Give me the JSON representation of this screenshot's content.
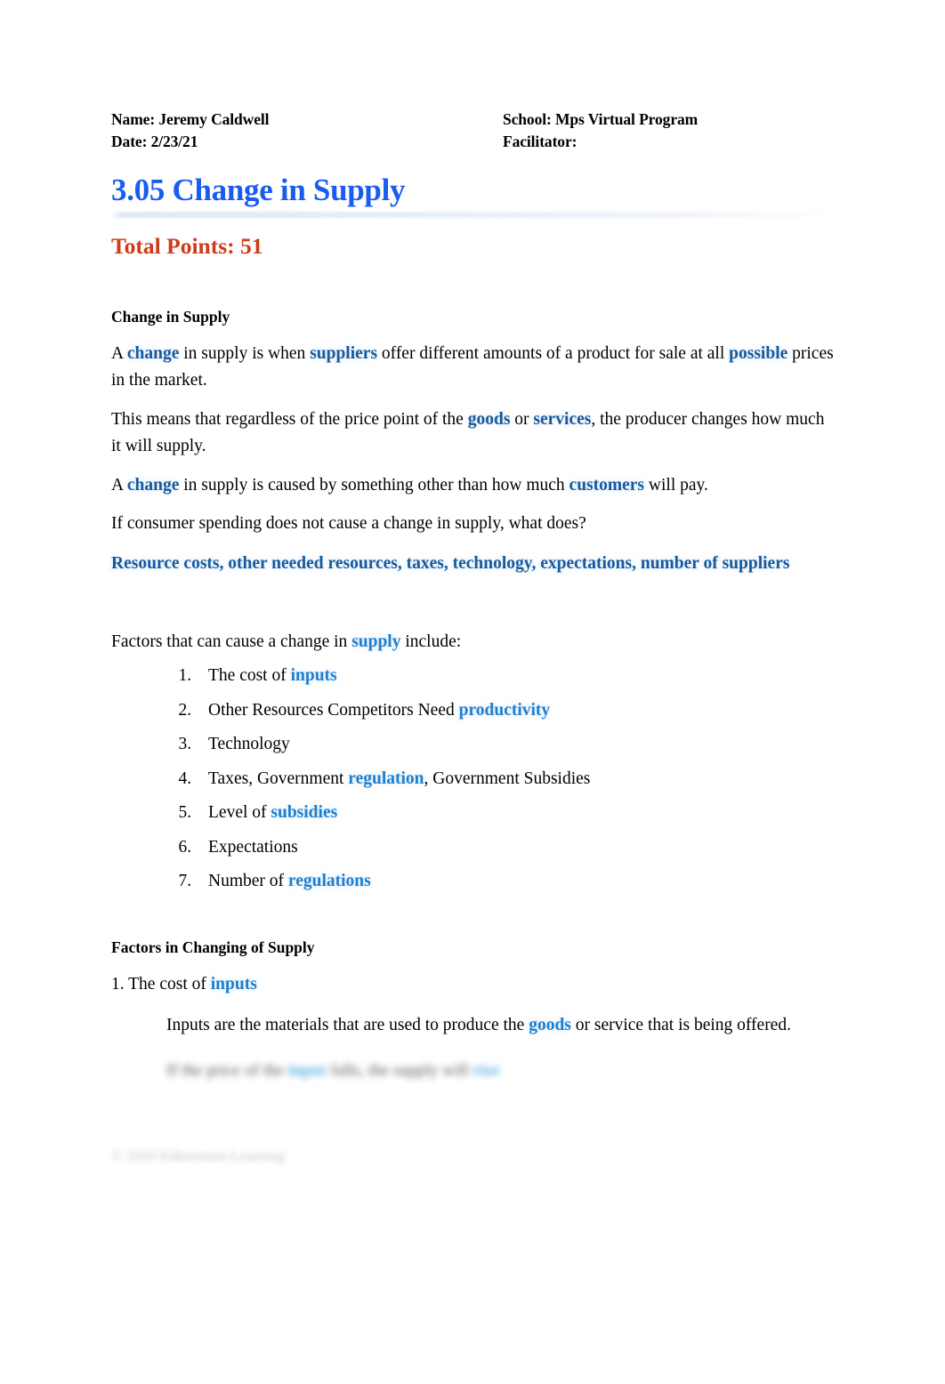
{
  "header": {
    "name_label": "Name: Jeremy Caldwell",
    "date_label": "Date: 2/23/21",
    "school_label": "School: Mps Virtual Program",
    "facilitator_label": "Facilitator:"
  },
  "title": "3.05 Change in Supply",
  "total_points": "Total Points: 51",
  "colors": {
    "title_blue": "#1a5cf0",
    "points_orange": "#d03a18",
    "answer_blue": "#16599e",
    "answer_bright_blue": "#1e7fd0"
  },
  "sections": {
    "change_in_supply": {
      "heading": "Change in Supply",
      "p1": {
        "a": "A ",
        "answer1": "change",
        "b": " in supply is when ",
        "answer2": "suppliers",
        "c": " offer different amounts of a product for sale at all ",
        "answer3": "possible",
        "d": " prices in the market."
      },
      "p2": {
        "a": "This means that regardless of the price point of the ",
        "answer1": "goods",
        "b": " or ",
        "answer2": "services",
        "c": ", the producer changes how much it will supply."
      },
      "p3": {
        "a": "A ",
        "answer1": "change",
        "b": " in supply is caused by something other than how much ",
        "answer2": "customers",
        "c": " will pay."
      },
      "question": "If consumer spending does not cause a change in supply, what does?",
      "question_answer": "Resource costs, other needed resources,  taxes, technology, expectations, number of suppliers",
      "factors_intro": {
        "a": "Factors that can cause a change in ",
        "answer1": "supply",
        "b": " include:"
      },
      "factors": [
        {
          "text_before": "The cost of ",
          "answer": "inputs",
          "text_after": ""
        },
        {
          "text_before": "Other Resources Competitors Need ",
          "answer": "productivity",
          "text_after": ""
        },
        {
          "text_before": "Technology",
          "answer": "",
          "text_after": ""
        },
        {
          "text_before": "Taxes, Government ",
          "answer": "regulation",
          "text_after": ", Government Subsidies"
        },
        {
          "text_before": "Level of ",
          "answer": "subsidies",
          "text_after": ""
        },
        {
          "text_before": "Expectations",
          "answer": "",
          "text_after": ""
        },
        {
          "text_before": "Number of ",
          "answer": "regulations",
          "text_after": ""
        }
      ]
    },
    "factors_in_changing": {
      "heading": "Factors in Changing of Supply",
      "item1": {
        "a": "1. The cost of ",
        "answer1": "inputs"
      },
      "item1_body": {
        "a": "Inputs are the materials that are used to produce the ",
        "answer1": "goods",
        "b": " or service that is being offered."
      },
      "obscured_line": {
        "a": "If the price of the ",
        "answer1": "input",
        "b": " falls, the supply will ",
        "answer2": "rise"
      }
    }
  },
  "footer": "© 2020 Edmentum Learning"
}
